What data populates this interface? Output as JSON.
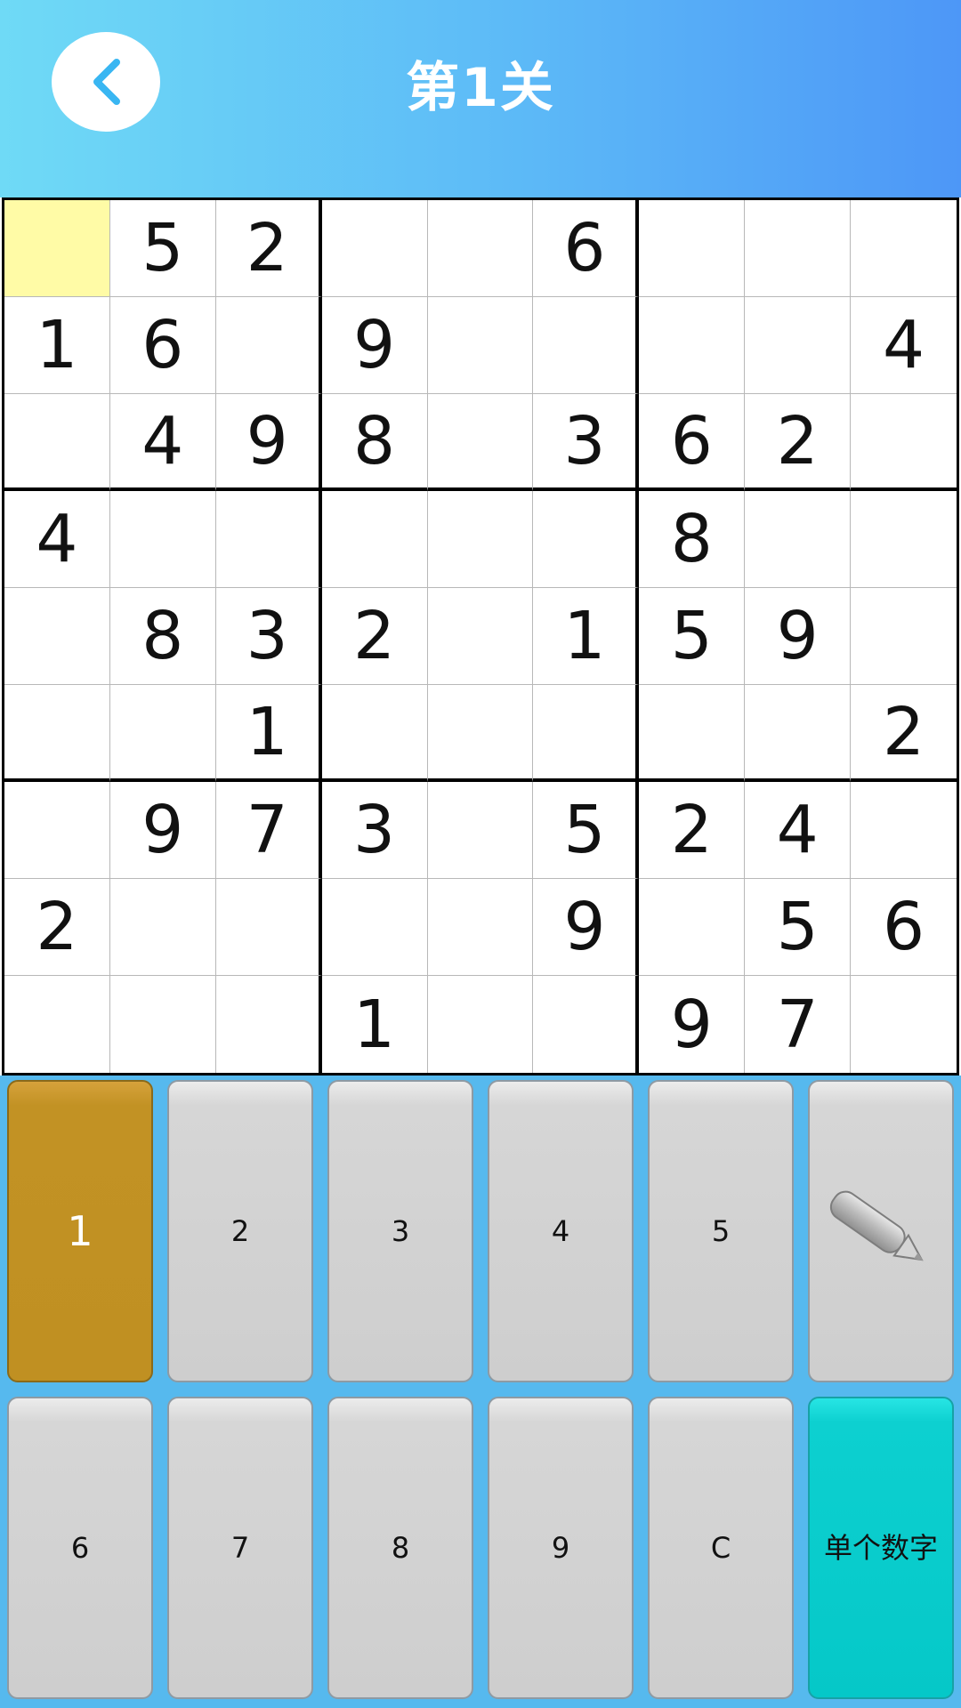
{
  "header": {
    "title": "第1关",
    "back_icon": "chevron-left-icon"
  },
  "colors": {
    "header_start": "#6fdaf6",
    "header_end": "#4d97f7",
    "selected_cell": "#fffba6",
    "keypad_bg": "#56b9ee",
    "key_gray": "#cecece",
    "key_active": "#c09022",
    "key_mode": "#05c8c8",
    "back_icon": "#39b6f2"
  },
  "board": {
    "selected_cell": {
      "row": 0,
      "col": 0
    },
    "grid": [
      [
        "",
        "5",
        "2",
        "",
        "",
        "6",
        "",
        "",
        ""
      ],
      [
        "1",
        "6",
        "",
        "9",
        "",
        "",
        "",
        "",
        "4"
      ],
      [
        "",
        "4",
        "9",
        "8",
        "",
        "3",
        "6",
        "2",
        ""
      ],
      [
        "4",
        "",
        "",
        "",
        "",
        "",
        "8",
        "",
        ""
      ],
      [
        "",
        "8",
        "3",
        "2",
        "",
        "1",
        "5",
        "9",
        ""
      ],
      [
        "",
        "",
        "1",
        "",
        "",
        "",
        "",
        "",
        "2"
      ],
      [
        "",
        "9",
        "7",
        "3",
        "",
        "5",
        "2",
        "4",
        ""
      ],
      [
        "2",
        "",
        "",
        "",
        "",
        "9",
        "",
        "5",
        "6"
      ],
      [
        "",
        "",
        "",
        "1",
        "",
        "",
        "9",
        "7",
        ""
      ]
    ]
  },
  "keypad": {
    "active_key": "1",
    "keys_row1": [
      "1",
      "2",
      "3",
      "4",
      "5"
    ],
    "pencil_icon": "pencil-icon",
    "keys_row2": [
      "6",
      "7",
      "8",
      "9",
      "C"
    ],
    "mode_label": "单个数字"
  }
}
